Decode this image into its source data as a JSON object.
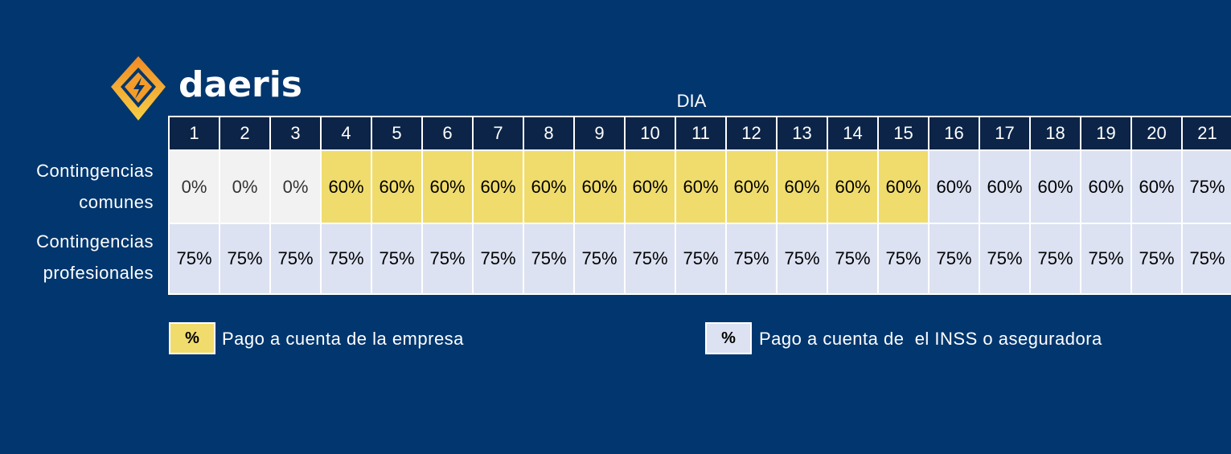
{
  "brand": {
    "name": "daeris",
    "colors": {
      "orange": "#f39c2a",
      "yellow": "#f5c842"
    }
  },
  "table": {
    "title": "DIA",
    "days": [
      "1",
      "2",
      "3",
      "4",
      "5",
      "6",
      "7",
      "8",
      "9",
      "10",
      "11",
      "12",
      "13",
      "14",
      "15",
      "16",
      "17",
      "18",
      "19",
      "20",
      "21",
      "..."
    ],
    "rows": [
      {
        "label_line1": "Contingencias",
        "label_line2": "comunes",
        "values": [
          "0%",
          "0%",
          "0%",
          "60%",
          "60%",
          "60%",
          "60%",
          "60%",
          "60%",
          "60%",
          "60%",
          "60%",
          "60%",
          "60%",
          "60%",
          "60%",
          "60%",
          "60%",
          "60%",
          "60%",
          "75%",
          "..."
        ],
        "payer": [
          "none",
          "none",
          "none",
          "empresa",
          "empresa",
          "empresa",
          "empresa",
          "empresa",
          "empresa",
          "empresa",
          "empresa",
          "empresa",
          "empresa",
          "empresa",
          "empresa",
          "inss",
          "inss",
          "inss",
          "inss",
          "inss",
          "inss",
          "inss"
        ]
      },
      {
        "label_line1": "Contingencias",
        "label_line2": "profesionales",
        "values": [
          "75%",
          "75%",
          "75%",
          "75%",
          "75%",
          "75%",
          "75%",
          "75%",
          "75%",
          "75%",
          "75%",
          "75%",
          "75%",
          "75%",
          "75%",
          "75%",
          "75%",
          "75%",
          "75%",
          "75%",
          "75%",
          "..."
        ],
        "payer": [
          "inss",
          "inss",
          "inss",
          "inss",
          "inss",
          "inss",
          "inss",
          "inss",
          "inss",
          "inss",
          "inss",
          "inss",
          "inss",
          "inss",
          "inss",
          "inss",
          "inss",
          "inss",
          "inss",
          "inss",
          "inss",
          "inss"
        ]
      }
    ],
    "colors": {
      "empresa": "#f0dc6c",
      "inss": "#dce2f2",
      "none": "#f2f2f2",
      "header": "#0c2447",
      "background": "#02366e"
    }
  },
  "legend": [
    {
      "symbol": "%",
      "label": "Pago a cuenta de la empresa",
      "payer": "empresa"
    },
    {
      "symbol": "%",
      "label": "Pago a cuenta de  el INSS o aseguradora",
      "payer": "inss"
    }
  ]
}
